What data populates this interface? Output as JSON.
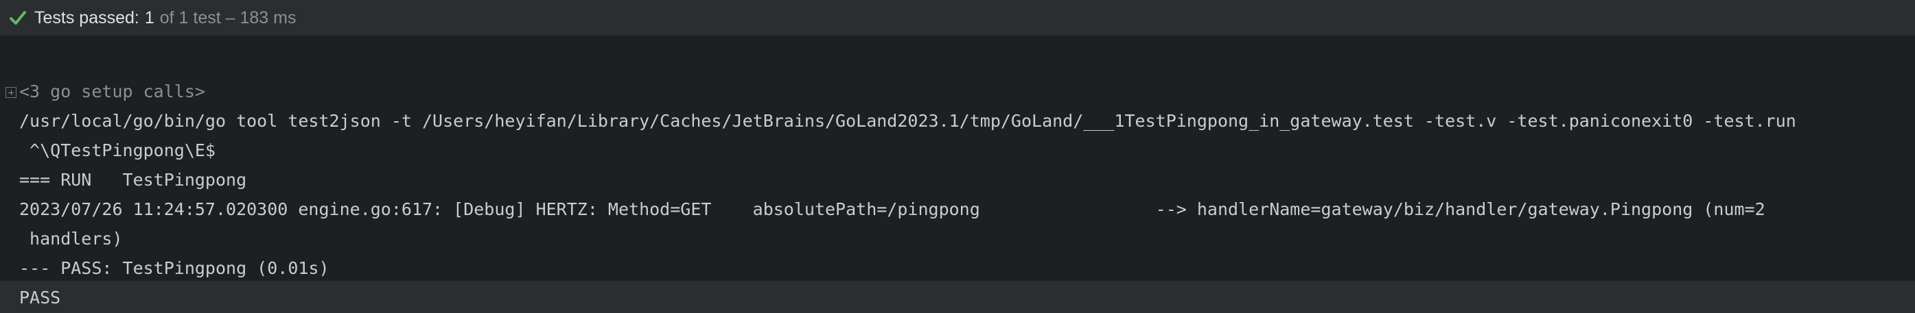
{
  "status": {
    "icon": "checkmark-icon",
    "icon_color": "#5fb865",
    "label": "Tests passed:",
    "passed_count": "1",
    "detail": "of 1 test – 183 ms"
  },
  "console": {
    "lines": [
      "<3 go setup calls>",
      "/usr/local/go/bin/go tool test2json -t /Users/heyifan/Library/Caches/JetBrains/GoLand2023.1/tmp/GoLand/___1TestPingpong_in_gateway.test -test.v -test.paniconexit0 -test.run",
      " ^\\QTestPingpong\\E$",
      "=== RUN   TestPingpong",
      "2023/07/26 11:24:57.020300 engine.go:617: [Debug] HERTZ: Method=GET    absolutePath=/pingpong                 --> handlerName=gateway/biz/handler/gateway.Pingpong (num=2",
      " handlers)",
      "--- PASS: TestPingpong (0.01s)",
      "PASS"
    ]
  }
}
